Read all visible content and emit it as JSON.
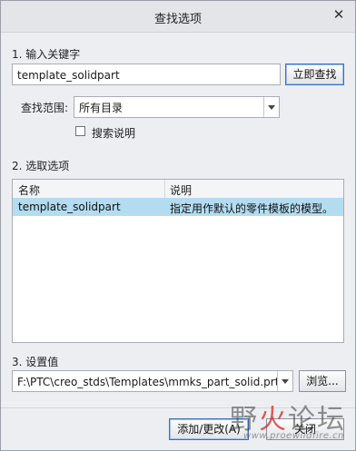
{
  "dialog": {
    "title": "查找选项",
    "close_glyph": "✕"
  },
  "section1": {
    "label": "1.  输入关键字",
    "keyword_value": "template_solidpart",
    "search_button": "立即查找",
    "scope_label": "查找范围:",
    "scope_value": "所有目录",
    "search_desc_label": "搜索说明",
    "search_desc_checked": false
  },
  "section2": {
    "label": "2.  选取选项",
    "columns": [
      "名称",
      "说明"
    ],
    "rows": [
      {
        "name": "template_solidpart",
        "desc": "指定用作默认的零件模板的模型。",
        "selected": true
      }
    ]
  },
  "section3": {
    "label": "3.  设置值",
    "path_value": "F:\\PTC\\creo_stds\\Templates\\mmks_part_solid.prt",
    "browse_button": "浏览..."
  },
  "footer": {
    "add_button": "添加/更改(A)",
    "close_button": "关闭"
  },
  "watermark": {
    "text_a": "野",
    "text_b": "火",
    "text_c": "论坛",
    "url": "www.proewildfire.cn"
  },
  "colors": {
    "selected_row": "#b3dcf1",
    "focus_border": "#3b6fb8"
  }
}
